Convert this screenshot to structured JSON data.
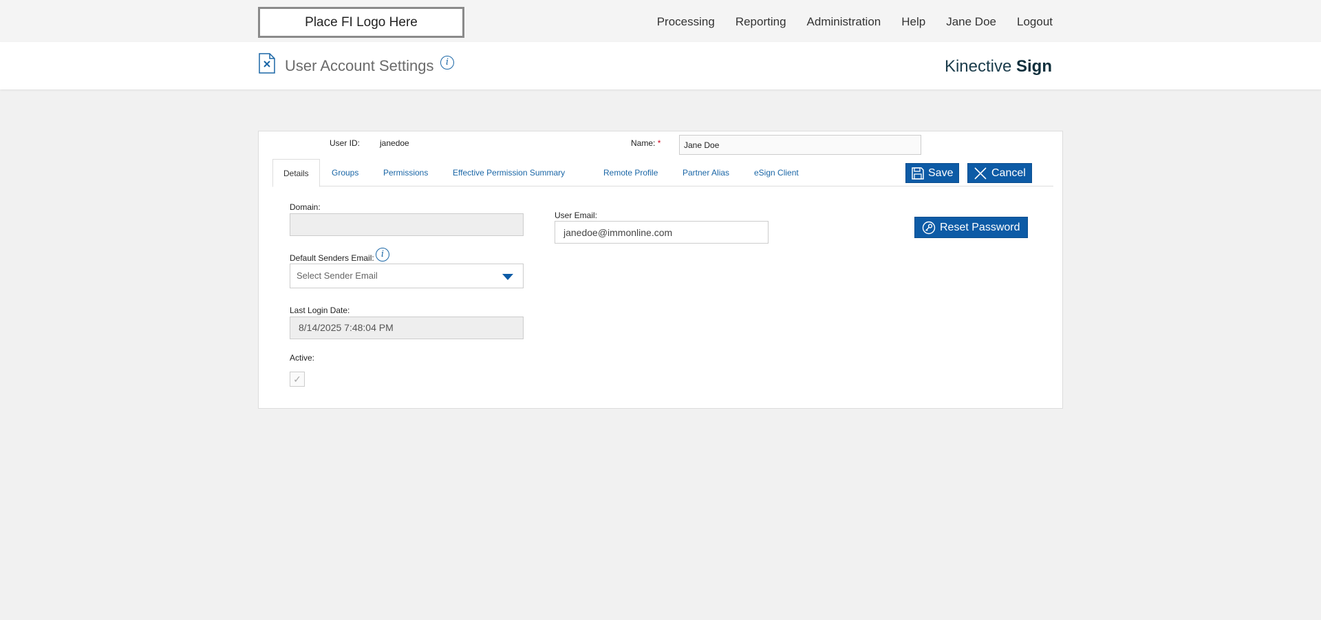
{
  "nav": {
    "logo": "Place FI Logo Here",
    "items": [
      "Processing",
      "Reporting",
      "Administration",
      "Help",
      "Jane Doe",
      "Logout"
    ]
  },
  "header": {
    "title": "User Account Settings",
    "brand_light": "Kinective ",
    "brand_bold": "Sign"
  },
  "user": {
    "id_label": "User ID:",
    "id_value": "janedoe",
    "name_label": "Name:",
    "name_required": "*",
    "name_value": "Jane Doe"
  },
  "tabs": [
    "Details",
    "Groups",
    "Permissions",
    "Effective Permission Summary",
    "Remote Profile",
    "Partner Alias",
    "eSign Client"
  ],
  "buttons": {
    "save": "Save",
    "cancel": "Cancel",
    "reset_password": "Reset Password"
  },
  "details": {
    "domain_label": "Domain:",
    "domain_value": "",
    "default_sender_label": "Default Senders Email:",
    "default_sender_placeholder": "Select Sender Email",
    "last_login_label": "Last Login Date:",
    "last_login_value": "8/14/2025 7:48:04 PM",
    "active_label": "Active:",
    "active_checked": true,
    "email_label": "User Email:",
    "email_value": "janedoe@immonline.com"
  },
  "colors": {
    "accent": "#0d5ba6",
    "link": "#1a66a6",
    "required": "#d0021b"
  }
}
